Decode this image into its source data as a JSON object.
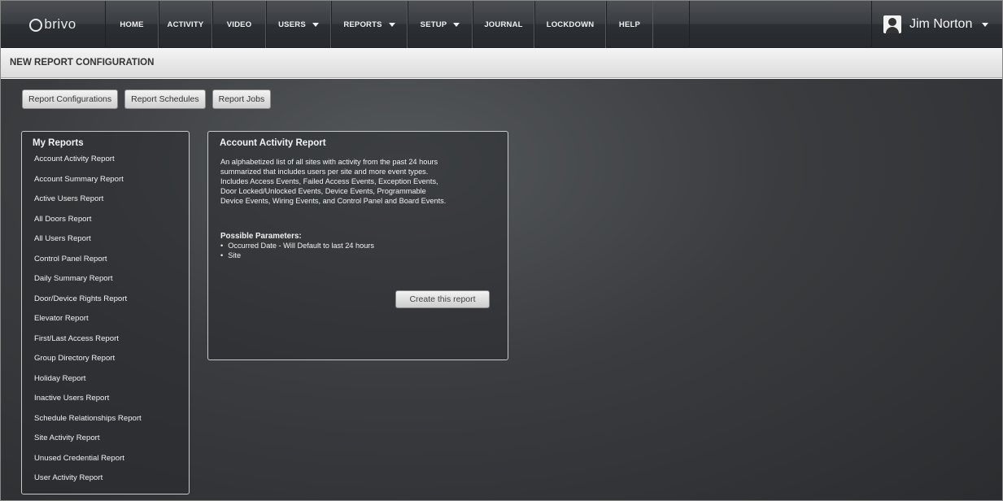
{
  "app": {
    "logo_text": "brivo",
    "user_name": "Jim Norton"
  },
  "nav": {
    "items": [
      {
        "label": "HOME",
        "dropdown": false
      },
      {
        "label": "ACTIVITY",
        "dropdown": false
      },
      {
        "label": "VIDEO",
        "dropdown": false
      },
      {
        "label": "USERS",
        "dropdown": true
      },
      {
        "label": "REPORTS",
        "dropdown": true
      },
      {
        "label": "SETUP",
        "dropdown": true
      },
      {
        "label": "JOURNAL",
        "dropdown": false
      },
      {
        "label": "LOCKDOWN",
        "dropdown": false
      },
      {
        "label": "HELP",
        "dropdown": false
      }
    ]
  },
  "page": {
    "title": "NEW REPORT CONFIGURATION"
  },
  "tabs": {
    "items": [
      "Report Configurations",
      "Report Schedules",
      "Report Jobs"
    ]
  },
  "my_reports": {
    "title": "My Reports",
    "items": [
      "Account Activity Report",
      "Account Summary Report",
      "Active Users Report",
      "All Doors Report",
      "All Users Report",
      "Control Panel Report",
      "Daily Summary Report",
      "Door/Device Rights Report",
      "Elevator Report",
      "First/Last Access Report",
      "Group Directory Report",
      "Holiday Report",
      "Inactive Users Report",
      "Schedule Relationships Report",
      "Site Activity Report",
      "Unused Credential Report",
      "User Activity Report"
    ]
  },
  "detail": {
    "title": "Account Activity Report",
    "description_lines": [
      "An alphabetized list of all sites with activity from the past 24 hours",
      "summarized that includes users per site and more event types.",
      "Includes Access Events, Failed Access Events, Exception Events,",
      "Door Locked/Unlocked Events, Device Events, Programmable",
      "Device Events, Wiring Events, and Control Panel and Board Events."
    ],
    "params_title": "Possible Parameters:",
    "params": [
      "Occurred Date - Will Default to last 24 hours",
      "Site"
    ],
    "create_button": "Create this report"
  },
  "colors": {
    "nav_bg": "#3a3d42",
    "main_bg": "#3a3c3f",
    "text_light": "#f2f2f2"
  }
}
